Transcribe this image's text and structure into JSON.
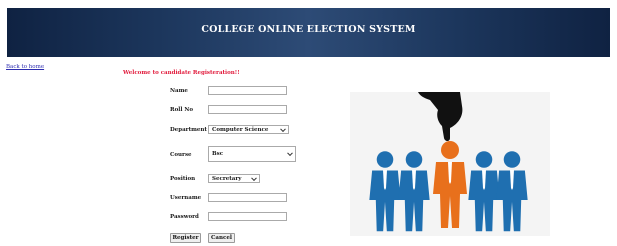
{
  "header": {
    "title": "COLLEGE ONLINE ELECTION SYSTEM"
  },
  "nav": {
    "back_link": "Back to home"
  },
  "form": {
    "welcome": "Welcome to candidate Registeration!!",
    "labels": {
      "name": "Name",
      "roll_no": "Roll No",
      "department": "Department",
      "course": "Course",
      "position": "Position",
      "username": "Username",
      "password": "Password"
    },
    "values": {
      "name": "",
      "roll_no": "",
      "department": "Computer Science",
      "course": "Bsc",
      "position": "Secretary",
      "username": "",
      "password": ""
    },
    "buttons": {
      "register": "Register",
      "cancel": "Cancel"
    }
  },
  "illustration": {
    "icon": "candidate-selection-hand-icon"
  },
  "colors": {
    "banner": "#1c365c",
    "welcome_text": "#e11b3c",
    "link": "#2d2db0",
    "selected_candidate": "#e8701c",
    "candidates": "#1f6fb0"
  }
}
